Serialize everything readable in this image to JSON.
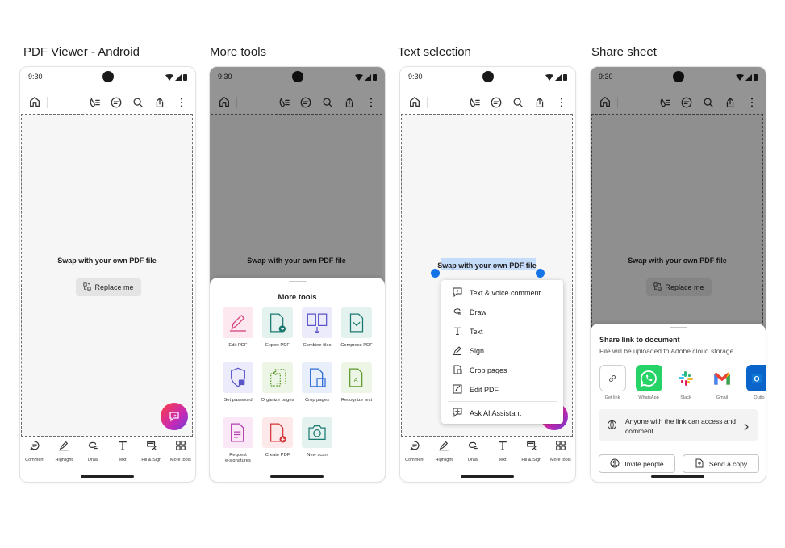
{
  "panels": [
    {
      "title": "PDF Viewer - Android"
    },
    {
      "title": "More tools"
    },
    {
      "title": "Text selection"
    },
    {
      "title": "Share sheet"
    }
  ],
  "status": {
    "time": "9:30"
  },
  "document": {
    "placeholder": "Swap with your own PDF file",
    "replace_label": "Replace me"
  },
  "bottom_bar": {
    "items": [
      {
        "label": "Comment",
        "icon": "comment-icon"
      },
      {
        "label": "Highlight",
        "icon": "highlight-icon"
      },
      {
        "label": "Draw",
        "icon": "draw-icon"
      },
      {
        "label": "Text",
        "icon": "text-icon"
      },
      {
        "label": "Fill & Sign",
        "icon": "fill-sign-icon"
      },
      {
        "label": "More tools",
        "icon": "more-tools-icon"
      }
    ]
  },
  "more_tools": {
    "title": "More tools",
    "tools": [
      {
        "label": "Edit PDF",
        "color": "#fde8ef"
      },
      {
        "label": "Export PDF",
        "color": "#e4f2ef"
      },
      {
        "label": "Combine files",
        "color": "#ecebfb"
      },
      {
        "label": "Compress PDF",
        "color": "#e4f2ef"
      },
      {
        "label": "Set password",
        "color": "#ecebfb"
      },
      {
        "label": "Organize pages",
        "color": "#edf6e6"
      },
      {
        "label": "Crop pages",
        "color": "#e8effb"
      },
      {
        "label": "Recognize text",
        "color": "#edf6e6"
      },
      {
        "label": "Request",
        "label2": "e-signatures",
        "color": "#fbe8f7"
      },
      {
        "label": "Create PDF",
        "color": "#fde8ea"
      },
      {
        "label": "New scan",
        "color": "#e4f2ef"
      }
    ]
  },
  "selection_menu": {
    "items": [
      {
        "label": "Text & voice comment",
        "icon": "text-voice-comment-icon"
      },
      {
        "label": "Draw",
        "icon": "draw-icon"
      },
      {
        "label": "Text",
        "icon": "text-icon"
      },
      {
        "label": "Sign",
        "icon": "sign-icon"
      },
      {
        "label": "Crop pages",
        "icon": "crop-pages-icon"
      },
      {
        "label": "Edit PDF",
        "icon": "edit-pdf-icon"
      },
      {
        "label": "Ask AI Assistant",
        "icon": "ai-assistant-icon"
      }
    ]
  },
  "share": {
    "title": "Share link to document",
    "subtitle": "File will be uploaded to Adobe cloud storage",
    "apps": [
      {
        "label": "Get link",
        "color": "#ffffff"
      },
      {
        "label": "WhatsApp",
        "color": "#25d366"
      },
      {
        "label": "Slack",
        "color": "#ffffff"
      },
      {
        "label": "Gmail",
        "color": "#ffffff"
      },
      {
        "label": "Outlo",
        "color": "#0a64c9"
      }
    ],
    "access_text": "Anyone with the link can access and comment",
    "invite_label": "Invite people",
    "send_label": "Send a copy"
  },
  "colors": {
    "accent": "#1473e6",
    "ai_gradient_start": "#ff3e3e",
    "ai_gradient_end": "#6c3bd6"
  }
}
